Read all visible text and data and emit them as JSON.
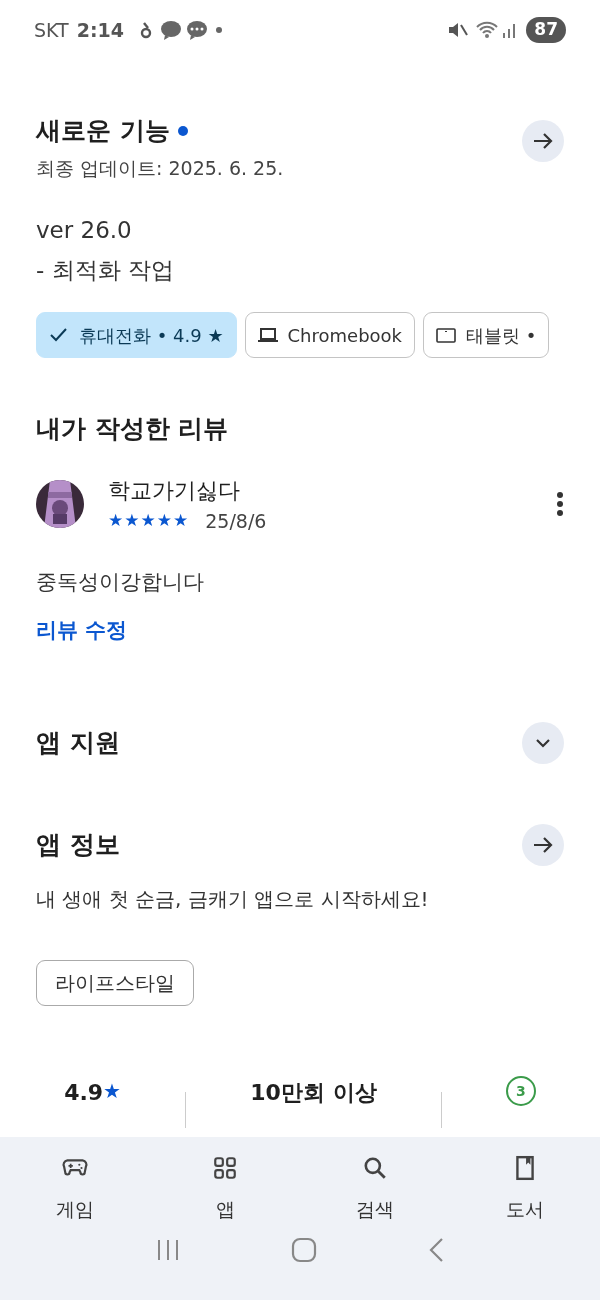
{
  "status_bar": {
    "carrier": "SKT",
    "time": "2:14",
    "battery": "87"
  },
  "whats_new": {
    "title": "새로운 기능",
    "has_new": true,
    "updated": "최종 업데이트: 2025. 6. 25.",
    "notes": [
      "ver 26.0",
      "- 최적화 작업"
    ]
  },
  "device_chips": [
    {
      "label": "휴대전화 • 4.9 ★",
      "selected": true
    },
    {
      "kind": "laptop",
      "label": "Chromebook",
      "selected": false
    },
    {
      "kind": "tablet",
      "label": "태블릿 •",
      "selected": false
    }
  ],
  "my_review": {
    "heading": "내가 작성한 리뷰",
    "reviewer": "학교가기싫다",
    "stars": 5,
    "date": "25/8/6",
    "text": "중독성이강합니다",
    "edit_link": "리뷰 수정"
  },
  "app_support": {
    "title": "앱 지원",
    "expanded": false
  },
  "app_info": {
    "title": "앱 정보",
    "description": "내 생애 첫 순금, 금캐기 앱으로 시작하세요!",
    "category": "라이프스타일"
  },
  "stats": [
    {
      "kind": "rating",
      "value": "4.9",
      "star": "★"
    },
    {
      "kind": "downloads",
      "value": "10만회 이상"
    },
    {
      "kind": "age",
      "value": "3"
    }
  ],
  "bottom_nav": [
    {
      "kind": "games",
      "label": "게임"
    },
    {
      "kind": "apps",
      "label": "앱"
    },
    {
      "kind": "search",
      "label": "검색"
    },
    {
      "kind": "books",
      "label": "도서"
    }
  ]
}
